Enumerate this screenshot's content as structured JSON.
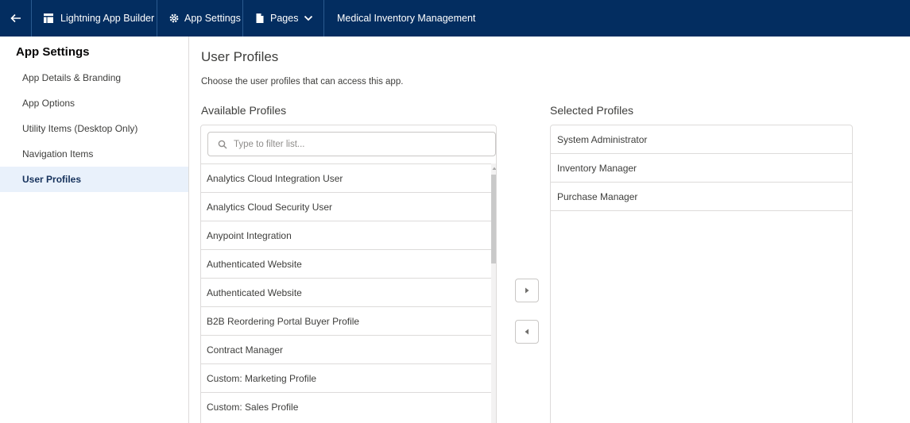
{
  "topbar": {
    "builder_label": "Lightning App Builder",
    "settings_label": "App Settings",
    "pages_label": "Pages",
    "app_title": "Medical Inventory Management"
  },
  "sidebar": {
    "heading": "App Settings",
    "items": [
      {
        "label": "App Details & Branding"
      },
      {
        "label": "App Options"
      },
      {
        "label": "Utility Items (Desktop Only)"
      },
      {
        "label": "Navigation Items"
      },
      {
        "label": "User Profiles"
      }
    ],
    "active_index": 4
  },
  "main": {
    "title": "User Profiles",
    "description": "Choose the user profiles that can access this app.",
    "available": {
      "title": "Available Profiles",
      "search_placeholder": "Type to filter list...",
      "items": [
        "Analytics Cloud Integration User",
        "Analytics Cloud Security User",
        "Anypoint Integration",
        "Authenticated Website",
        "Authenticated Website",
        "B2B Reordering Portal Buyer Profile",
        "Contract Manager",
        "Custom: Marketing Profile",
        "Custom: Sales Profile"
      ]
    },
    "selected": {
      "title": "Selected Profiles",
      "items": [
        "System Administrator",
        "Inventory Manager",
        "Purchase Manager"
      ]
    }
  },
  "colors": {
    "topbar_bg": "#032d60",
    "active_bg": "#e9f1fb",
    "border": "#dddbda"
  }
}
